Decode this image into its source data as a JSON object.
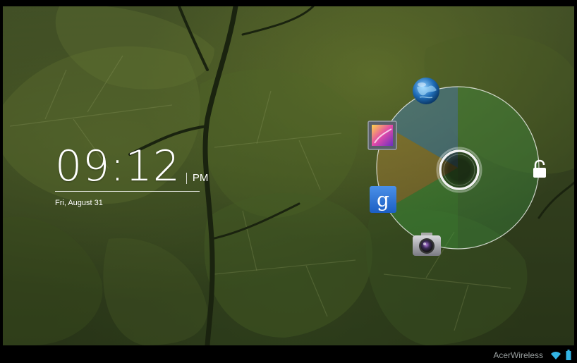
{
  "lockscreen": {
    "time": "09:12",
    "ampm": "PM",
    "date": "Fri, August 31"
  },
  "shortcuts": [
    {
      "name": "browser",
      "icon": "globe-icon"
    },
    {
      "name": "gallery",
      "icon": "gallery-icon"
    },
    {
      "name": "google-search",
      "icon": "google-icon"
    },
    {
      "name": "camera",
      "icon": "camera-icon"
    }
  ],
  "unlock": {
    "handle_icon": "unlock-handle-icon",
    "target_icon": "padlock-icon"
  },
  "status_bar": {
    "network_name": "AcerWireless",
    "wifi_icon": "wifi-icon",
    "battery_icon": "battery-icon",
    "colors": {
      "wifi": "#33b5e5",
      "battery": "#33b5e5"
    }
  }
}
